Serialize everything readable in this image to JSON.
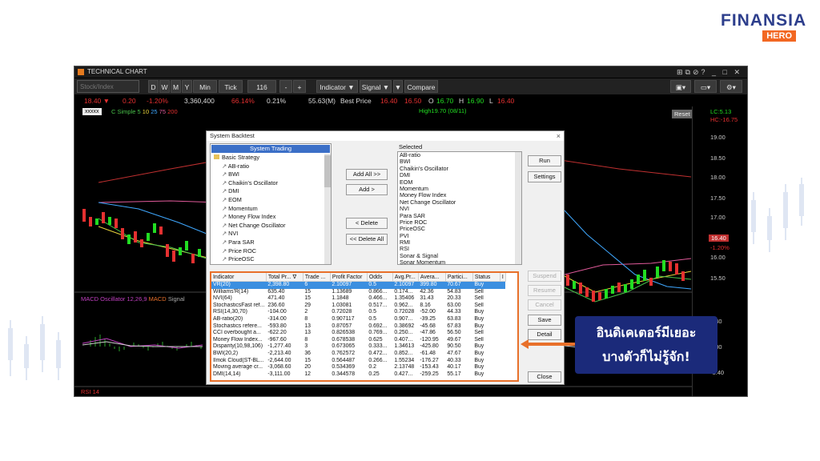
{
  "brand": {
    "name": "FINANSIA",
    "sub": "HERO"
  },
  "window": {
    "title": "TECHNICAL CHART",
    "symbol_placeholder": "Stock/Index",
    "periods": [
      "D",
      "W",
      "M",
      "Y",
      "Min",
      "Tick"
    ],
    "bars_value": "116",
    "zoom_in": "+",
    "zoom_out": "-",
    "indicator_label": "Indicator ▼",
    "signal_label": "Signal ▼",
    "signal_dd": "▼",
    "compare_label": "Compare"
  },
  "quote": {
    "last": "18.40 ▼",
    "change": "0.20",
    "pct": "-1.20%",
    "volume": "3,360,400",
    "ratio": "66.14%",
    "ratio2": "0.21%",
    "value": "55.63(M)",
    "best_price_label": "Best Price",
    "bid": "16.40",
    "offer": "16.50",
    "o_label": "O",
    "o": "16.70",
    "h_label": "H",
    "h": "16.90",
    "l_label": "L",
    "l": "16.40"
  },
  "chart": {
    "legend_name": "C Simple",
    "legend_periods": [
      "5",
      "10",
      "25",
      "75",
      "200"
    ],
    "symbol_box": "xxxxx",
    "reset_scale": "Reset Scale",
    "lc": "LC:5.13",
    "hc": "HC:-16.75",
    "high_marker": "High19.70 (08/11)",
    "price_axis": [
      "19.00",
      "18.50",
      "18.00",
      "17.50",
      "17.00",
      "16.00",
      "15.50"
    ],
    "last_tag": "16.40",
    "last_pct": "-1.20%",
    "macd_legend": "MACD Oscillator 12,26,9",
    "macd_name": "MACD",
    "signal_name": "Signal",
    "macd_axis": [
      "0.40",
      "0.00",
      "-0.40"
    ],
    "rsi_legend": "RSI 14",
    "colors": {
      "up": "#22dd22",
      "down": "#e53030",
      "ma_blue": "#3fa8ff",
      "ma_yellow": "#e8d23a",
      "ma_pink": "#e05a9a",
      "ma_red": "#c03030",
      "ma_green": "#49c24a"
    }
  },
  "dialog": {
    "title": "System Backtest",
    "close": "×",
    "left_header": "System Trading",
    "root": "Basic Strategy",
    "strategies": [
      "AB-ratio",
      "BWI",
      "Chaikin's Oscillator",
      "DMI",
      "EOM",
      "Momentum",
      "Money Flow Index",
      "Net Change Oscillator",
      "NVI",
      "Para SAR",
      "Price ROC",
      "PriceOSC"
    ],
    "selected_header": "Selected",
    "selected": [
      "AB-ratio",
      "BWI",
      "Chaikin's Oscillator",
      "DMI",
      "EOM",
      "Momentum",
      "Money Flow Index",
      "Net Change Oscillator",
      "NVI",
      "Para SAR",
      "Price ROC",
      "PriceOSC",
      "PVI",
      "RMI",
      "RSI",
      "Sonar & Signal",
      "Sonar Momentum"
    ],
    "buttons": {
      "add_all": "Add All >>",
      "add": "Add >",
      "delete": "< Delete",
      "delete_all": "<< Delete All",
      "run": "Run",
      "settings": "Settings",
      "suspend": "Suspend",
      "resume": "Resume",
      "cancel": "Cancel",
      "save": "Save",
      "detail": "Detail",
      "close": "Close"
    },
    "columns": [
      "Indicator",
      "Total Pr... ∇",
      "Trade ...",
      "Profit Factor",
      "Odds",
      "Avg.Pr...",
      "Avera...",
      "Partici...",
      "Status",
      "I"
    ],
    "rows": [
      [
        "VR(20)",
        "2,398.80",
        "6",
        "2.10097",
        "0.5",
        "2.10097",
        "399.80",
        "70.67",
        "Buy"
      ],
      [
        "Williams'R(14)",
        "635.40",
        "15",
        "1.13689",
        "0.866...",
        "0.174...",
        "42.36",
        "54.83",
        "Sell"
      ],
      [
        "NVI(64)",
        "471.40",
        "15",
        "1.1848",
        "0.466...",
        "1.35406",
        "31.43",
        "20.33",
        "Sell"
      ],
      [
        "StochasticsFast ref...",
        "236.60",
        "29",
        "1.03081",
        "0.517...",
        "0.962...",
        "8.16",
        "63.00",
        "Sell"
      ],
      [
        "RSI(14,30,70)",
        "-104.00",
        "2",
        "0.72028",
        "0.5",
        "0.72028",
        "-52.00",
        "44.33",
        "Buy"
      ],
      [
        "AB-ratio(20)",
        "-314.00",
        "8",
        "0.907117",
        "0.5",
        "0.907...",
        "-39.25",
        "63.83",
        "Buy"
      ],
      [
        "Stochastics refere...",
        "-593.80",
        "13",
        "0.87057",
        "0.692...",
        "0.38692",
        "-45.68",
        "67.83",
        "Buy"
      ],
      [
        "CCI overbought a...",
        "-622.20",
        "13",
        "0.826538",
        "0.769...",
        "0.250...",
        "-47.86",
        "56.50",
        "Sell"
      ],
      [
        "Money Flow Index...",
        "-967.60",
        "8",
        "0.678538",
        "0.625",
        "0.407...",
        "-120.95",
        "49.67",
        "Sell"
      ],
      [
        "Disparity(10,98,106)",
        "-1,277.40",
        "3",
        "0.673065",
        "0.333...",
        "1.34613",
        "-425.80",
        "90.50",
        "Buy"
      ],
      [
        "BWI(20,2)",
        "-2,213.40",
        "36",
        "0.762572",
        "0.472...",
        "0.852...",
        "-61.48",
        "47.67",
        "Buy"
      ],
      [
        "Ilmok Cloud(ST-BL...",
        "-2,644.00",
        "15",
        "0.564487",
        "0.266...",
        "1.55234",
        "-176.27",
        "40.33",
        "Buy"
      ],
      [
        "Moving average cr...",
        "-3,068.60",
        "20",
        "0.534369",
        "0.2",
        "2.13748",
        "-153.43",
        "40.17",
        "Buy"
      ],
      [
        "DMI(14,14)",
        "-3,111.00",
        "12",
        "0.344578",
        "0.25",
        "0.427...",
        "-259.25",
        "55.17",
        "Buy"
      ]
    ]
  },
  "callout": {
    "line1": "อินดิเคเตอร์มีเยอะ",
    "line2": "บางตัวก็ไม่รู้จัก!"
  }
}
